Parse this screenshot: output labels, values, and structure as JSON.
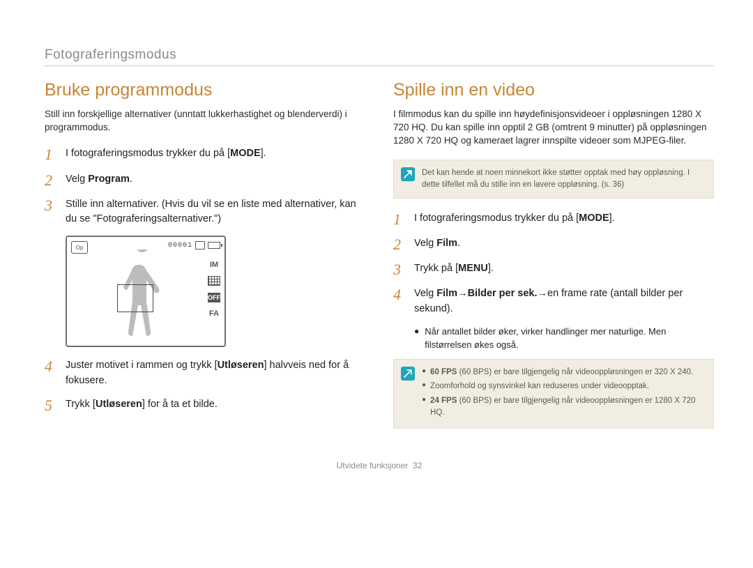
{
  "header": {
    "section": "Fotograferingsmodus"
  },
  "left": {
    "title": "Bruke programmodus",
    "intro": "Still inn forskjellige alternativer (unntatt lukkerhastighet og blenderverdi) i programmodus.",
    "steps": {
      "s1_pre": "I fotograferingsmodus trykker du på [",
      "s1_kbd": "MODE",
      "s1_post": "].",
      "s2_pre": "Velg ",
      "s2_bold": "Program",
      "s2_post": ".",
      "s3": "Stille inn alternativer. (Hvis du vil se en liste med alternativer, kan du se \"Fotograferingsalternativer.\")",
      "s4_pre": "Juster motivet i rammen og trykk [",
      "s4_kbd": "Utløseren",
      "s4_post": "] halvveis ned for å fokusere.",
      "s5_pre": "Trykk [",
      "s5_kbd": "Utløseren",
      "s5_post": "] for å ta et bilde."
    },
    "lcd": {
      "mode_label": "Op",
      "counter": "00001",
      "side": {
        "label1": "IM",
        "label3": "OFF",
        "label4": "FA"
      }
    }
  },
  "right": {
    "title": "Spille inn en video",
    "intro": "I filmmodus kan du spille inn høydefinisjonsvideoer i oppløsningen 1280 X 720 HQ. Du kan spille inn opptil 2 GB (omtrent 9 minutter) på oppløsningen 1280 X 720 HQ og kameraet lagrer innspilte videoer som MJPEG-filer.",
    "note1": "Det kan hende at noen minnekort ikke støtter opptak med høy oppløsning. I dette tilfellet må du stille inn en lavere oppløsning. (s. 36)",
    "steps": {
      "s1_pre": "I fotograferingsmodus trykker du på [",
      "s1_kbd": "MODE",
      "s1_post": "].",
      "s2_pre": "Velg ",
      "s2_bold": "Film",
      "s2_post": ".",
      "s3_pre": "Trykk på [",
      "s3_kbd": "MENU",
      "s3_post": "].",
      "s4_pre": "Velg ",
      "s4_b1": "Film",
      "s4_arrow1": " → ",
      "s4_b2": "Bilder per sek.",
      "s4_arrow2": " → ",
      "s4_post": "en frame rate (antall bilder per sekund).",
      "s4_bullet": "Når antallet bilder øker, virker handlinger mer naturlige. Men filstørrelsen økes også."
    },
    "note2": {
      "b1_bold": "60 FPS",
      "b1_rest": " (60 BPS) er bare tilgjengelig når videooppløsningen er 320 X 240.",
      "b2": "Zoomforhold og synsvinkel kan reduseres under videoopptak.",
      "b3_bold": "24 FPS",
      "b3_rest": " (60 BPS) er bare tilgjengelig når videooppløsningen er 1280 X 720 HQ."
    }
  },
  "footer": {
    "label": "Utvidete funksjoner",
    "page": "32"
  }
}
